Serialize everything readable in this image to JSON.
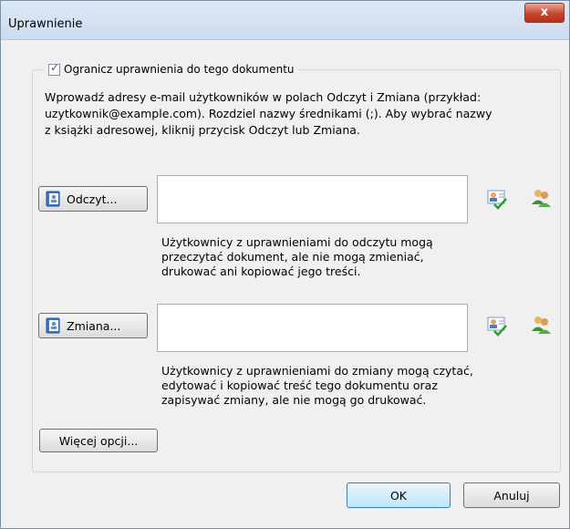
{
  "window": {
    "title": "Uprawnienie",
    "close_symbol": "x"
  },
  "restrict": {
    "label": "Ogranicz uprawnienia do tego dokumentu",
    "checked": true,
    "description": "Wprowadź adresy e-mail użytkowników w polach Odczyt i Zmiana (przykład:\nuzytkownik@example.com). Rozdziel nazwy średnikami (;). Aby wybrać nazwy\nz książki adresowej, kliknij przycisk Odczyt lub Zmiana."
  },
  "read": {
    "button_label": "Odczyt...",
    "value": "",
    "help": "Użytkownicy z uprawnieniami do odczytu mogą\nprzeczytać dokument, ale nie mogą zmieniać,\ndrukować ani kopiować jego treści."
  },
  "change": {
    "button_label": "Zmiana...",
    "value": "",
    "help": "Użytkownicy z uprawnieniami do zmiany mogą czytać,\nedytować i kopiować treść tego dokumentu oraz\nzapisywać zmiany, ale nie mogą go drukować."
  },
  "more_options_label": "Więcej opcji...",
  "ok_label": "OK",
  "cancel_label": "Anuluj",
  "icons": {
    "address_book": "address-book-icon",
    "check_names": "check-names-icon",
    "add_users": "add-users-icon"
  }
}
